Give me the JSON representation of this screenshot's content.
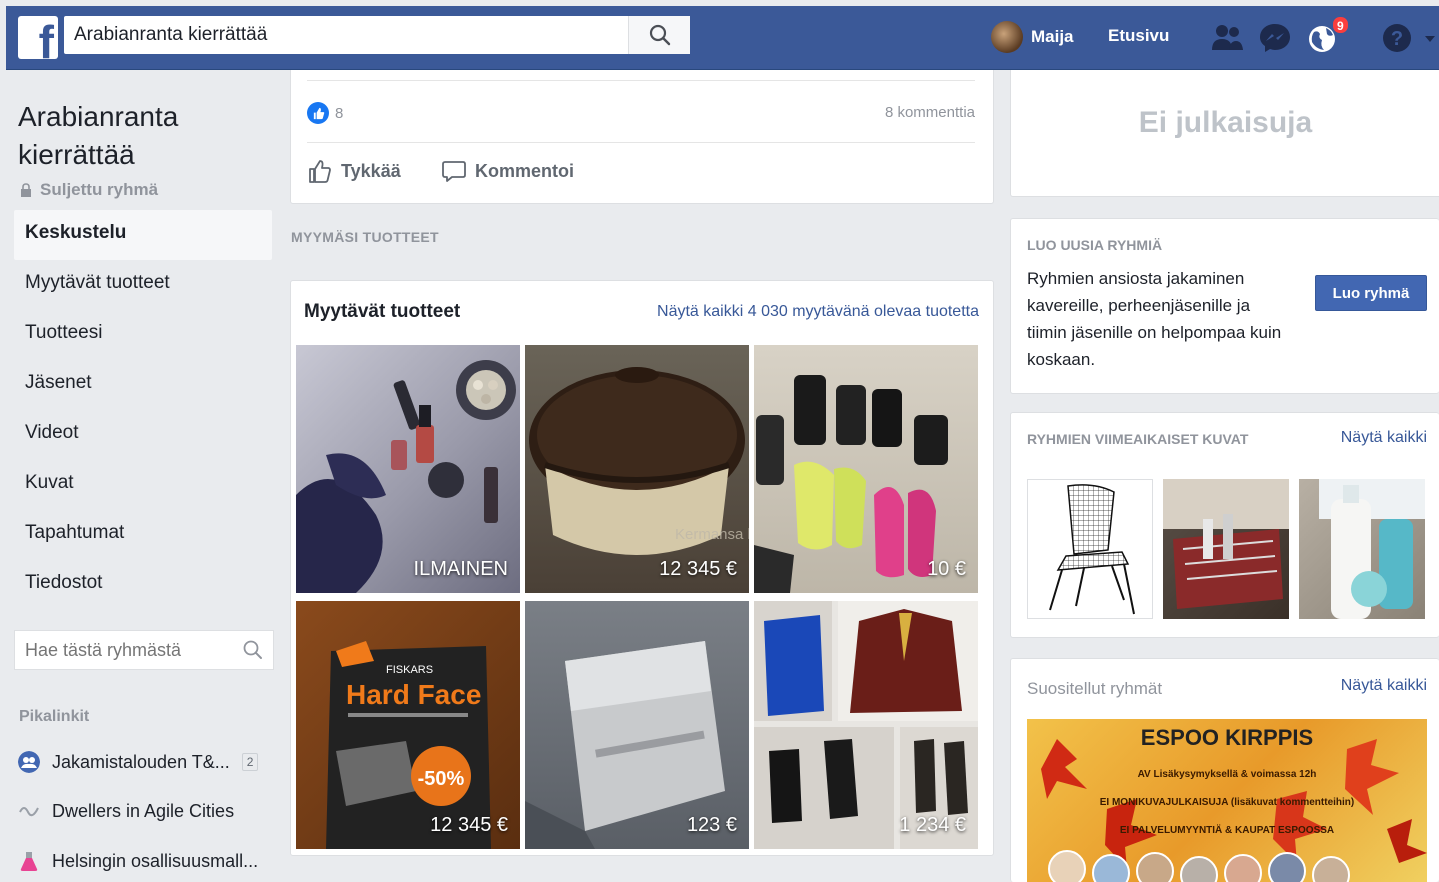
{
  "topbar": {
    "search_value": "Arabianranta kierrättää",
    "user_name": "Maija",
    "home_label": "Etusivu",
    "notifications_count": "9"
  },
  "left": {
    "group_title": "Arabianranta kierrättää",
    "group_status": "Suljettu ryhmä",
    "nav": [
      {
        "label": "Keskustelu"
      },
      {
        "label": "Myytävät tuotteet"
      },
      {
        "label": "Tuotteesi"
      },
      {
        "label": "Jäsenet"
      },
      {
        "label": "Videot"
      },
      {
        "label": "Kuvat"
      },
      {
        "label": "Tapahtumat"
      },
      {
        "label": "Tiedostot"
      }
    ],
    "search_placeholder": "Hae tästä ryhmästä",
    "shortcuts_title": "Pikalinkit",
    "shortcuts": [
      {
        "label": "Jakamistalouden T&...",
        "count": "2"
      },
      {
        "label": "Dwellers in Agile Cities"
      },
      {
        "label": "Helsingin osallisuusmall..."
      }
    ]
  },
  "post": {
    "reaction_count": "8",
    "comments": "8 kommenttia",
    "like_label": "Tykkää",
    "comment_label": "Kommentoi"
  },
  "products": {
    "section_label": "MYYMÄSI TUOTTEET",
    "title": "Myytävät tuotteet",
    "see_all": "Näytä kaikki 4 030 myytävänä olevaa tuotetta",
    "items": [
      {
        "price": "ILMAINEN"
      },
      {
        "price": "12 345 €",
        "overlay": "Kermansa kannellin"
      },
      {
        "price": "10 €"
      },
      {
        "price": "12 345 €",
        "brand": "FISKARS",
        "headline": "Hard Face",
        "discount": "-50%"
      },
      {
        "price": "123 €"
      },
      {
        "price": "1 234 €"
      }
    ]
  },
  "right": {
    "no_posts": "Ei julkaisuja",
    "create_label": "LUO UUSIA RYHMIÄ",
    "create_text": "Ryhmien ansiosta jakaminen kavereille, perheenjäsenille ja tiimin jäsenille on helpompaa kuin koskaan.",
    "create_button": "Luo ryhmä",
    "photos_label": "RYHMIEN VIIMEAIKAISET KUVAT",
    "photos_link": "Näytä kaikki",
    "suggested_label": "Suositellut ryhmät",
    "suggested_link": "Näytä kaikki",
    "suggested_banner": {
      "title": "ESPOO KIRPPIS",
      "line1": "AV Lisäkysymyksellä & voimassa 12h",
      "line2": "EI MONIKUVAJULKAISUJA (lisäkuvat kommentteihin)",
      "line3": "EI PALVELUMYYNTIÄ & KAUPAT ESPOOSSA"
    }
  },
  "colors": {
    "brand": "#3b5998",
    "link": "#385898",
    "button": "#4267b2",
    "badge": "#fa3e3e"
  }
}
